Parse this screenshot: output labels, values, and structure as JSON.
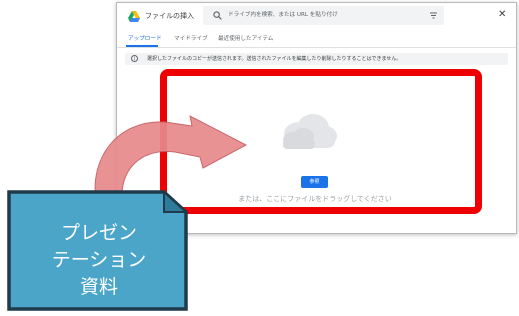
{
  "dialog": {
    "title": "ファイルの挿入",
    "search_placeholder": "ドライブ内を検索、または URL を貼り付け",
    "sort_icon": "filter-icon",
    "close_label": "✕",
    "tabs": [
      {
        "label": "アップロード",
        "active": true
      },
      {
        "label": "マイドライブ",
        "active": false
      },
      {
        "label": "最近使用したアイテム",
        "active": false
      }
    ],
    "banner_icon": "ⓘ",
    "banner_text": "選択したファイルのコピーが送信されます。送信されたファイルを編集したり削除したりすることはできません。",
    "browse_label": "参照",
    "drop_text": "または、ここにファイルをドラッグしてください"
  },
  "callout": {
    "lines": [
      "プレゼン",
      "テーション",
      "資料"
    ]
  },
  "colors": {
    "accent": "#1a73e8",
    "highlight": "#ee0000",
    "callout_fill": "#4aa5c8",
    "callout_border": "#1f3a4a",
    "arrow": "#e8898c"
  }
}
